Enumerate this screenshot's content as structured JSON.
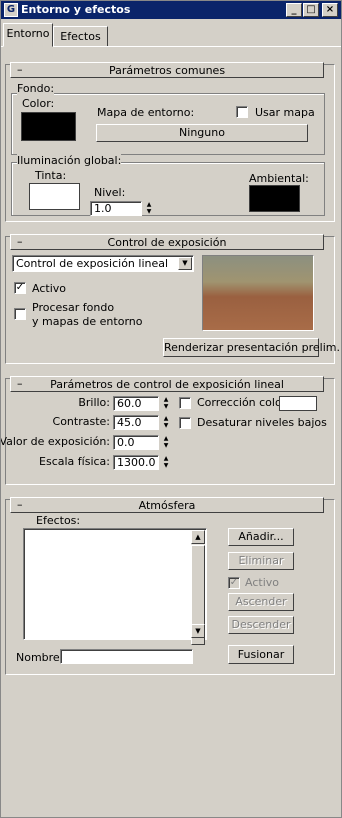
{
  "window": {
    "title": "Entorno y efectos",
    "app_icon": "G"
  },
  "tabs": [
    {
      "label": "Entorno"
    },
    {
      "label": "Efectos"
    }
  ],
  "parametros_comunes": {
    "title": "Parámetros comunes",
    "fondo": {
      "group_label": "Fondo:",
      "color_label": "Color:",
      "color": "#000000",
      "env_map_label": "Mapa de entorno:",
      "use_map_label": "Usar mapa",
      "use_map_checked": false,
      "map_button": "Ninguno"
    },
    "iluminacion": {
      "group_label": "Iluminación global:",
      "tint_label": "Tinta:",
      "tint_color": "#ffffff",
      "level_label": "Nivel:",
      "level_value": "1.0",
      "ambient_label": "Ambiental:",
      "ambient_color": "#000000"
    }
  },
  "control_exposicion": {
    "title": "Control de exposición",
    "dropdown_value": "Control de exposición lineal",
    "active_label": "Activo",
    "active_checked": true,
    "process_bg_line1": "Procesar fondo",
    "process_bg_line2": "y mapas de entorno",
    "process_bg_checked": false,
    "render_button": "Renderizar presentación prelim."
  },
  "parametros_lineal": {
    "title": "Parámetros de control de exposición lineal",
    "brillo_label": "Brillo:",
    "brillo_value": "60.0",
    "contraste_label": "Contraste:",
    "contraste_value": "45.0",
    "exposicion_label": "Valor de exposición:",
    "exposicion_value": "0.0",
    "escala_label": "Escala física:",
    "escala_value": "1300.0",
    "color_correction_label": "Corrección color:",
    "color_correction_checked": false,
    "color_correction_color": "#ffffff",
    "desaturate_label": "Desaturar niveles bajos",
    "desaturate_checked": false
  },
  "atmosfera": {
    "title": "Atmósfera",
    "effects_label": "Efectos:",
    "add_button": "Añadir...",
    "remove_button": "Eliminar",
    "active_label": "Activo",
    "active_checked": true,
    "up_button": "Ascender",
    "down_button": "Descender",
    "name_label": "Nombre:",
    "name_value": "",
    "merge_button": "Fusionar"
  },
  "glyphs": {
    "minus": "–",
    "check": "✓",
    "up": "▲",
    "down": "▼",
    "minimize": "_",
    "maximize": "□",
    "close": "×"
  }
}
